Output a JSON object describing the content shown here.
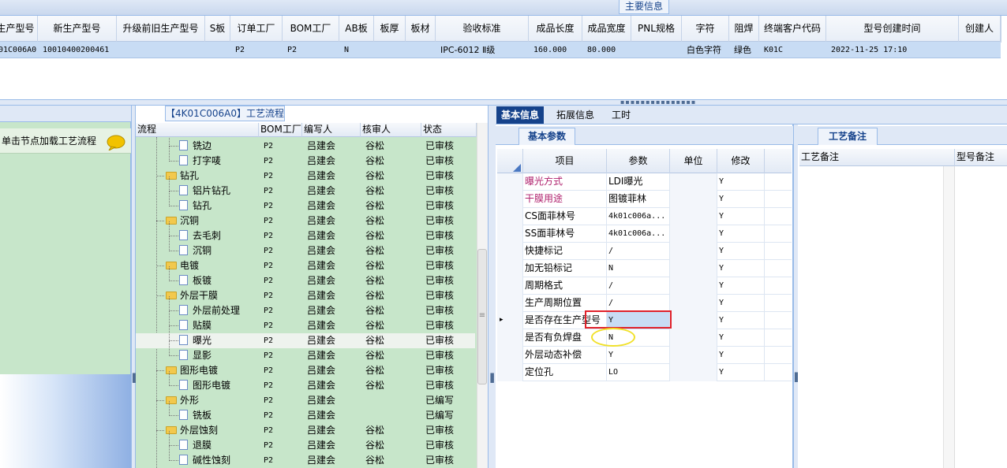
{
  "main_info": {
    "title": "主要信息",
    "columns": [
      "生产型号",
      "新生产型号",
      "升级前旧生产型号",
      "S板",
      "订单工厂",
      "BOM工厂",
      "AB板",
      "板厚",
      "板材",
      "验收标准",
      "成品长度",
      "成品宽度",
      "PNL规格",
      "字符",
      "阻焊",
      "终端客户代码",
      "型号创建时间",
      "创建人"
    ],
    "row": [
      "01C006A0",
      "10010400200461",
      "",
      "",
      "P2",
      "P2",
      "N",
      "",
      "",
      "IPC-6012 Ⅱ级",
      "160.000",
      "80.000",
      "",
      "白色字符",
      "绿色",
      "K01C",
      "2022-11-25 17:10",
      ""
    ]
  },
  "left_panel": {
    "message": "单击节点加载工艺流程"
  },
  "process_flow": {
    "tab_title": "【4K01C006A0】工艺流程",
    "columns": [
      "流程",
      "BOM工厂",
      "编写人",
      "核审人",
      "状态"
    ],
    "rows": [
      {
        "name": "铣边",
        "level": 2,
        "bom": "P2",
        "writer": "吕建会",
        "reviewer": "谷松",
        "status": "已审核"
      },
      {
        "name": "打字唛",
        "level": 2,
        "bom": "P2",
        "writer": "吕建会",
        "reviewer": "谷松",
        "status": "已审核"
      },
      {
        "name": "钻孔",
        "level": 1,
        "bom": "P2",
        "writer": "吕建会",
        "reviewer": "谷松",
        "status": "已审核"
      },
      {
        "name": "铝片钻孔",
        "level": 2,
        "bom": "P2",
        "writer": "吕建会",
        "reviewer": "谷松",
        "status": "已审核"
      },
      {
        "name": "钻孔",
        "level": 2,
        "bom": "P2",
        "writer": "吕建会",
        "reviewer": "谷松",
        "status": "已审核"
      },
      {
        "name": "沉铜",
        "level": 1,
        "bom": "P2",
        "writer": "吕建会",
        "reviewer": "谷松",
        "status": "已审核"
      },
      {
        "name": "去毛刺",
        "level": 2,
        "bom": "P2",
        "writer": "吕建会",
        "reviewer": "谷松",
        "status": "已审核"
      },
      {
        "name": "沉铜",
        "level": 2,
        "bom": "P2",
        "writer": "吕建会",
        "reviewer": "谷松",
        "status": "已审核"
      },
      {
        "name": "电镀",
        "level": 1,
        "bom": "P2",
        "writer": "吕建会",
        "reviewer": "谷松",
        "status": "已审核"
      },
      {
        "name": "板镀",
        "level": 2,
        "bom": "P2",
        "writer": "吕建会",
        "reviewer": "谷松",
        "status": "已审核"
      },
      {
        "name": "外层干膜",
        "level": 1,
        "bom": "P2",
        "writer": "吕建会",
        "reviewer": "谷松",
        "status": "已审核"
      },
      {
        "name": "外层前处理",
        "level": 2,
        "bom": "P2",
        "writer": "吕建会",
        "reviewer": "谷松",
        "status": "已审核"
      },
      {
        "name": "贴膜",
        "level": 2,
        "bom": "P2",
        "writer": "吕建会",
        "reviewer": "谷松",
        "status": "已审核"
      },
      {
        "name": "曝光",
        "level": 2,
        "bom": "P2",
        "writer": "吕建会",
        "reviewer": "谷松",
        "status": "已审核",
        "selected": true
      },
      {
        "name": "显影",
        "level": 2,
        "bom": "P2",
        "writer": "吕建会",
        "reviewer": "谷松",
        "status": "已审核"
      },
      {
        "name": "图形电镀",
        "level": 1,
        "bom": "P2",
        "writer": "吕建会",
        "reviewer": "谷松",
        "status": "已审核"
      },
      {
        "name": "图形电镀",
        "level": 2,
        "bom": "P2",
        "writer": "吕建会",
        "reviewer": "谷松",
        "status": "已审核"
      },
      {
        "name": "外形",
        "level": 1,
        "bom": "P2",
        "writer": "吕建会",
        "reviewer": "",
        "status": "已编写"
      },
      {
        "name": "铣板",
        "level": 2,
        "bom": "P2",
        "writer": "吕建会",
        "reviewer": "",
        "status": "已编写"
      },
      {
        "name": "外层蚀刻",
        "level": 1,
        "bom": "P2",
        "writer": "吕建会",
        "reviewer": "谷松",
        "status": "已审核"
      },
      {
        "name": "退膜",
        "level": 2,
        "bom": "P2",
        "writer": "吕建会",
        "reviewer": "谷松",
        "status": "已审核"
      },
      {
        "name": "碱性蚀刻",
        "level": 2,
        "bom": "P2",
        "writer": "吕建会",
        "reviewer": "谷松",
        "status": "已审核"
      }
    ]
  },
  "right_tabs": [
    "基本信息",
    "拓展信息",
    "工时"
  ],
  "basic_params": {
    "tab_title": "基本参数",
    "columns": [
      "项目",
      "参数",
      "单位",
      "修改"
    ],
    "rows": [
      {
        "item": "曝光方式",
        "param": "LDI曝光",
        "unit": "",
        "mod": "Y",
        "highlight": true
      },
      {
        "item": "干膜用途",
        "param": "图镀菲林",
        "unit": "",
        "mod": "Y",
        "highlight": true
      },
      {
        "item": "CS面菲林号",
        "param": "4k01c006a...",
        "unit": "",
        "mod": "Y"
      },
      {
        "item": "SS面菲林号",
        "param": "4k01c006a...",
        "unit": "",
        "mod": "Y"
      },
      {
        "item": "快捷标记",
        "param": "/",
        "unit": "",
        "mod": "Y"
      },
      {
        "item": "加无铅标记",
        "param": "N",
        "unit": "",
        "mod": "Y"
      },
      {
        "item": "周期格式",
        "param": "/",
        "unit": "",
        "mod": "Y"
      },
      {
        "item": "生产周期位置",
        "param": "/",
        "unit": "",
        "mod": "Y"
      },
      {
        "item": "是否存在生产型号",
        "param": "Y",
        "unit": "",
        "mod": "Y",
        "current": true
      },
      {
        "item": "是否有负焊盘",
        "param": "N",
        "unit": "",
        "mod": "Y"
      },
      {
        "item": "外层动态补偿",
        "param": "Y",
        "unit": "",
        "mod": "Y"
      },
      {
        "item": "定位孔",
        "param": "LO",
        "unit": "",
        "mod": "Y"
      }
    ]
  },
  "process_notes": {
    "tab_title": "工艺备注",
    "columns": [
      "工艺备注",
      "型号备注"
    ]
  },
  "colors": {
    "selected_tab": "#15428b",
    "panel_green": "#c7e6ca",
    "highlight_red": "#e0212a",
    "highlight_yellow": "#f1e12a",
    "row_selected": "#c8dcf4"
  }
}
